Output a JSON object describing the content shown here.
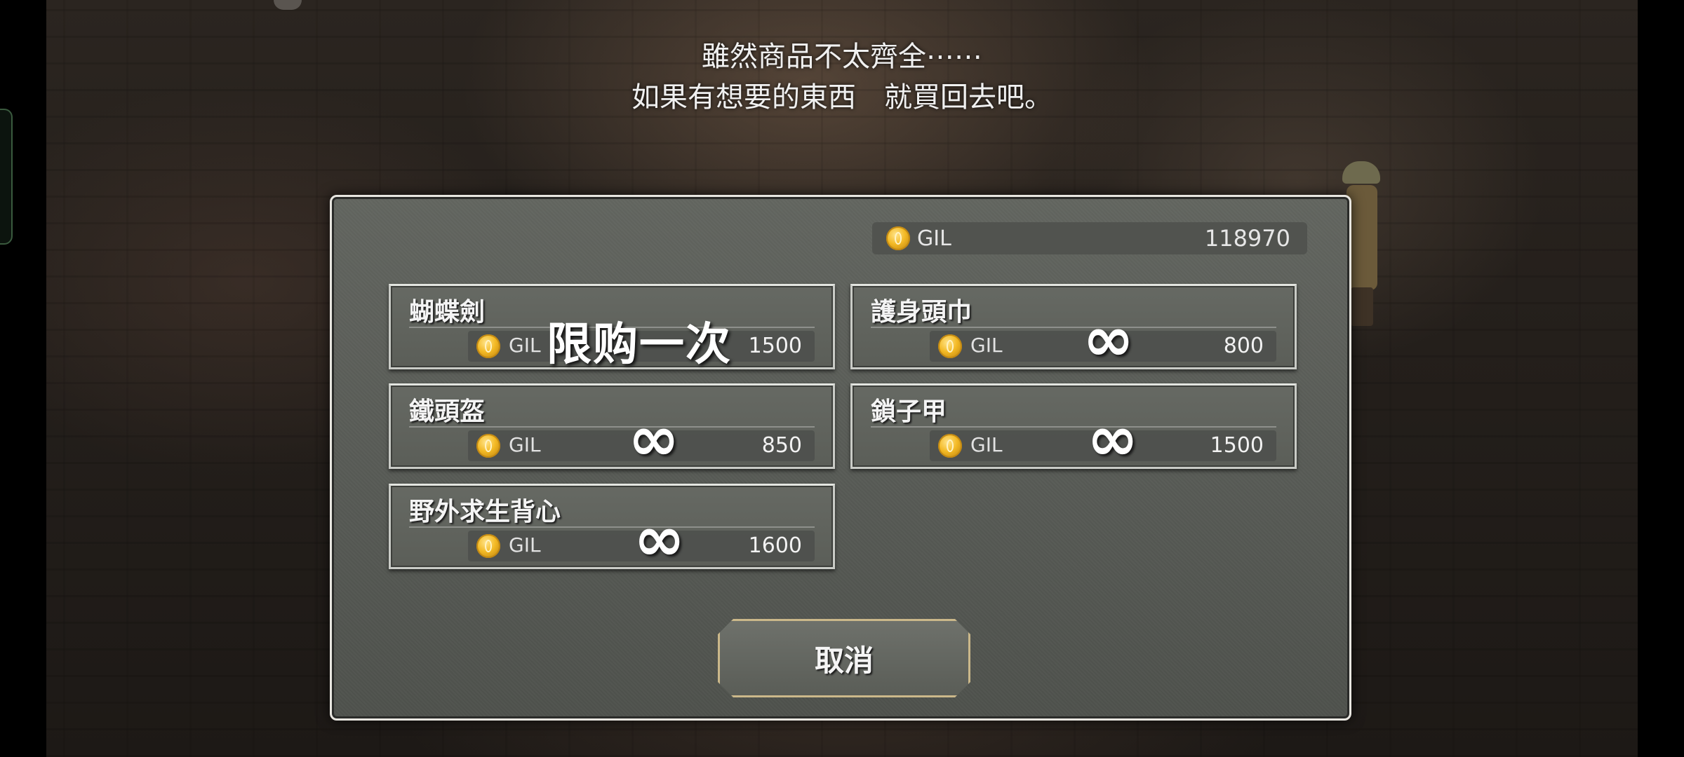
{
  "dialog": {
    "line1": "雖然商品不太齊全⋯⋯",
    "line2": "如果有想要的東西　就買回去吧。"
  },
  "wallet": {
    "currency": "GIL",
    "amount": "118970"
  },
  "items": [
    {
      "name": "蝴蝶劍",
      "currency": "GIL",
      "price": "1500",
      "limit_label": "限购一次"
    },
    {
      "name": "護身頭巾",
      "currency": "GIL",
      "price": "800",
      "stock": "∞"
    },
    {
      "name": "鐵頭盔",
      "currency": "GIL",
      "price": "850",
      "stock": "∞"
    },
    {
      "name": "鎖子甲",
      "currency": "GIL",
      "price": "1500",
      "stock": "∞"
    },
    {
      "name": "野外求生背心",
      "currency": "GIL",
      "price": "1600",
      "stock": "∞"
    }
  ],
  "buttons": {
    "cancel": "取消"
  },
  "colors": {
    "panel": "#5b5e58",
    "coin": "#f3b924",
    "button_border": "#cbb88a"
  }
}
